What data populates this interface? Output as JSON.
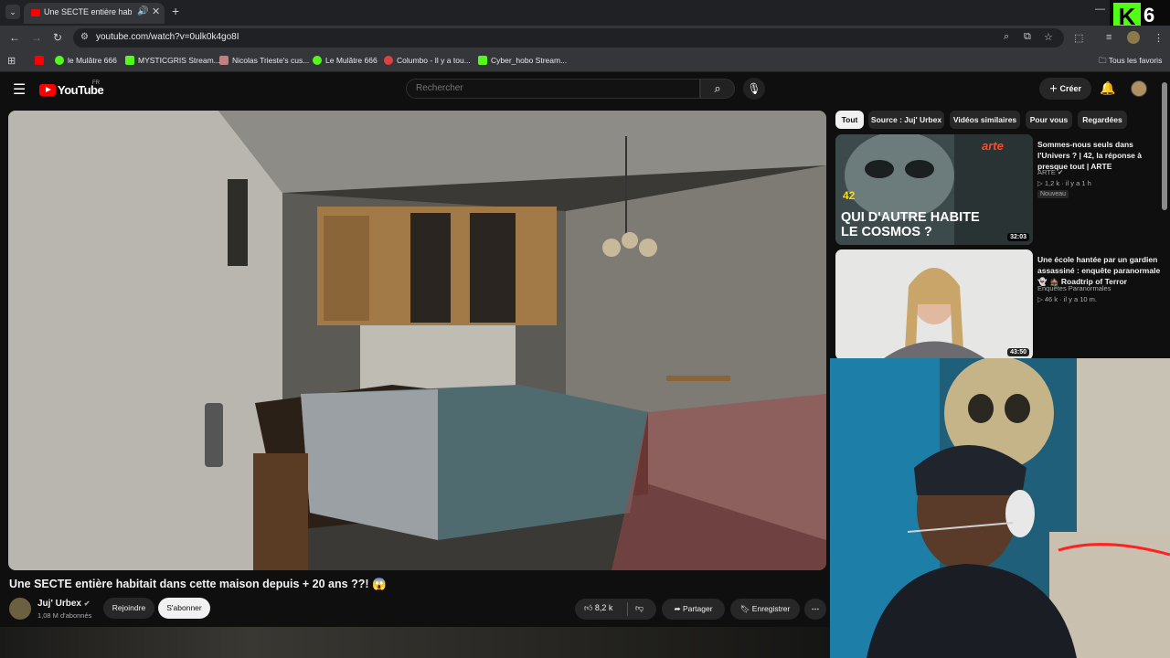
{
  "browser": {
    "tab_title": "Une SECTE entière habitait",
    "url": "youtube.com/watch?v=0ulk0k4go8I",
    "bookmarks": [
      {
        "label": "le Mulâtre 666",
        "color": "#53fc18"
      },
      {
        "label": "MYSTICGRIS Stream...",
        "color": "#53fc18"
      },
      {
        "label": "Nicolas Trieste's cus...",
        "color": "#c08080"
      },
      {
        "label": "Le Mulâtre 666",
        "color": "#53fc18"
      },
      {
        "label": "Columbo - Il y a tou...",
        "color": "#e04040"
      },
      {
        "label": "Cyber_hobo Stream...",
        "color": "#53fc18"
      }
    ],
    "all_favorites": "Tous les favoris"
  },
  "overlay": {
    "kick_letter": "K",
    "kick_number": "6"
  },
  "youtube": {
    "logo": "YouTube",
    "region": "FR",
    "search_placeholder": "Rechercher",
    "create_label": "Créer",
    "video": {
      "title": "Une SECTE entière habitait dans cette maison depuis + 20 ans ??! 😱",
      "channel": "Juj' Urbex",
      "subscribers": "1,08 M d'abonnés",
      "join_label": "Rejoindre",
      "subscribe_label": "S'abonner",
      "likes": "8,2 k",
      "share_label": "Partager",
      "save_label": "Enregistrer"
    },
    "chips": [
      "Tout",
      "Source : Juj' Urbex",
      "Vidéos similaires",
      "Pour vous",
      "Regardées"
    ],
    "recommendations": [
      {
        "title": "Sommes-nous seuls dans l'Univers ? | 42, la réponse à presque tout | ARTE",
        "channel": "ARTE",
        "views": "1,2 k",
        "age": "il y a 1 h",
        "badge": "Nouveau",
        "duration": "32:03",
        "thumb_text_1": "QUI D'AUTRE HABITE",
        "thumb_text_2": "LE COSMOS ?",
        "thumb_logo": "arte",
        "thumb_mark": "42"
      },
      {
        "title": "Une école hantée par un gardien assassiné : enquête paranormale 👻 🏚️ Roadtrip of Terror",
        "channel": "Enquêtes Paranormales",
        "views": "46 k",
        "age": "il y a 10 m.",
        "duration": "43:50"
      }
    ]
  }
}
